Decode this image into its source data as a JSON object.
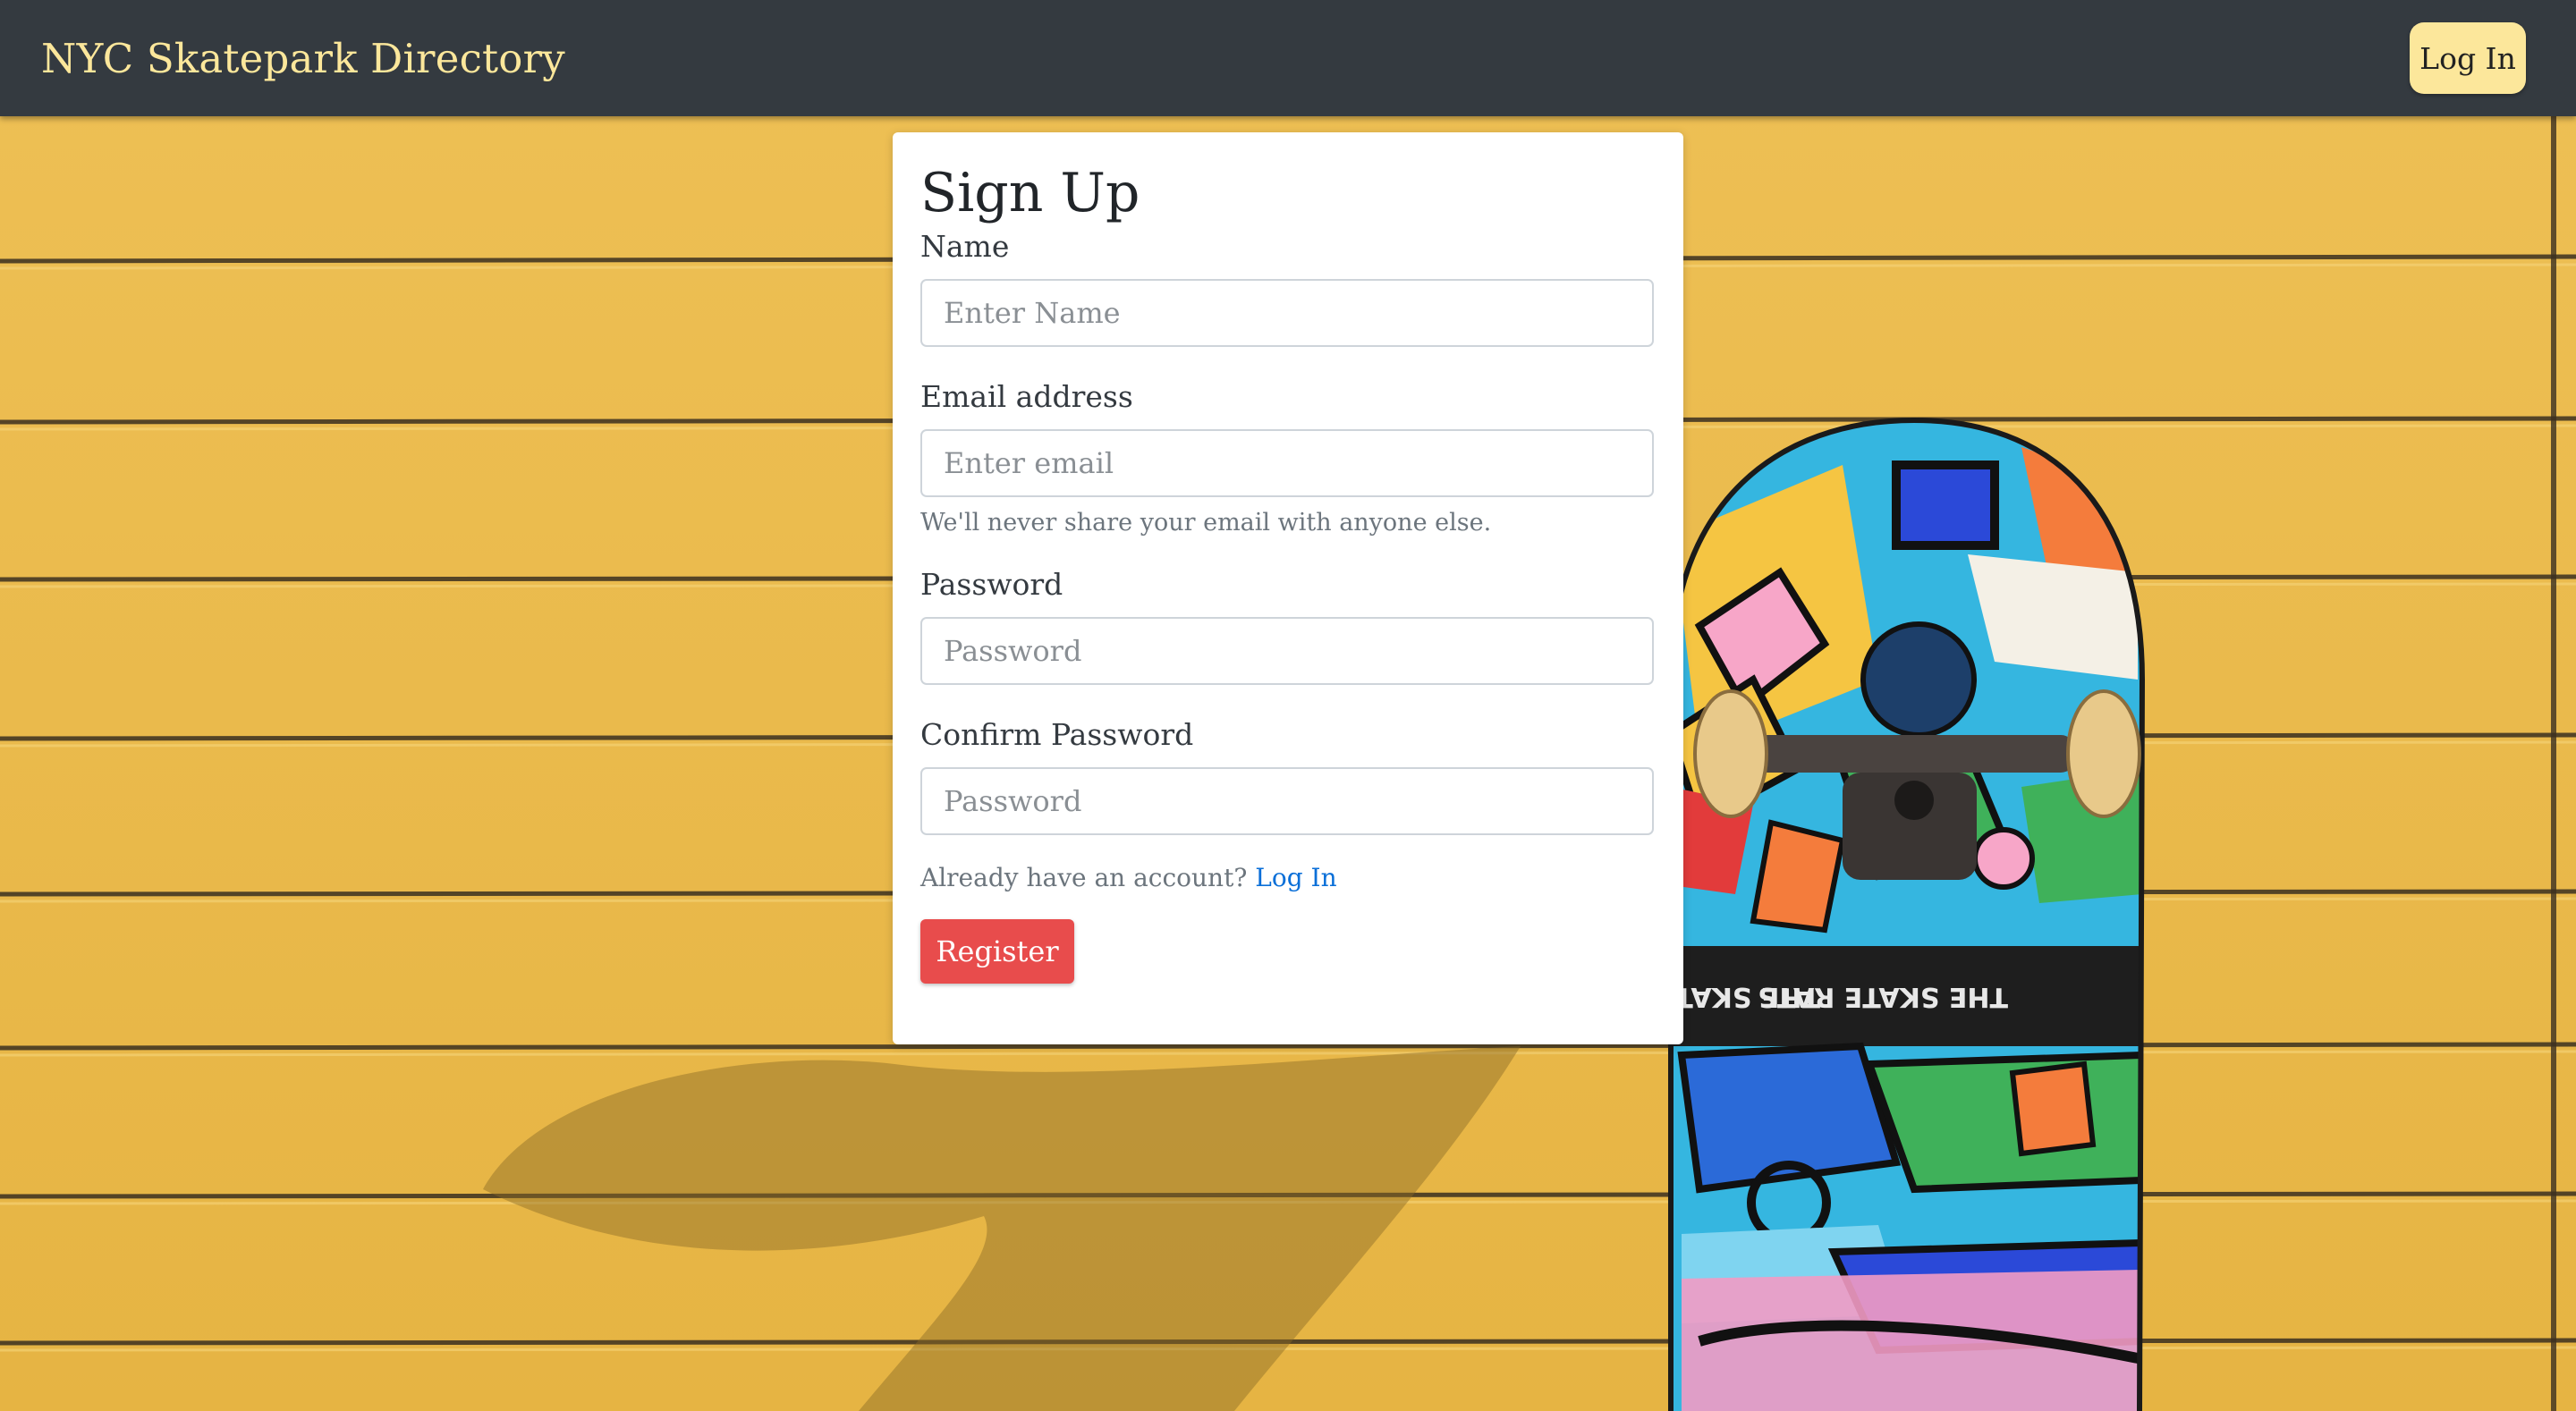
{
  "navbar": {
    "brand": "NYC Skatepark Directory",
    "login_label": "Log In"
  },
  "form": {
    "title": "Sign Up",
    "name": {
      "label": "Name",
      "placeholder": "Enter Name"
    },
    "email": {
      "label": "Email address",
      "placeholder": "Enter email",
      "help": "We'll never share your email with anyone else."
    },
    "password": {
      "label": "Password",
      "placeholder": "Password"
    },
    "confirm_password": {
      "label": "Confirm Password",
      "placeholder": "Password"
    },
    "account_prompt": "Already have an account?",
    "login_link": "Log In",
    "register_label": "Register"
  },
  "colors": {
    "navbar_bg": "#343a40",
    "brand_text": "#fce79b",
    "register_button": "#e84c4c",
    "link": "#0a6fd8",
    "wall": "#e8b84a"
  }
}
